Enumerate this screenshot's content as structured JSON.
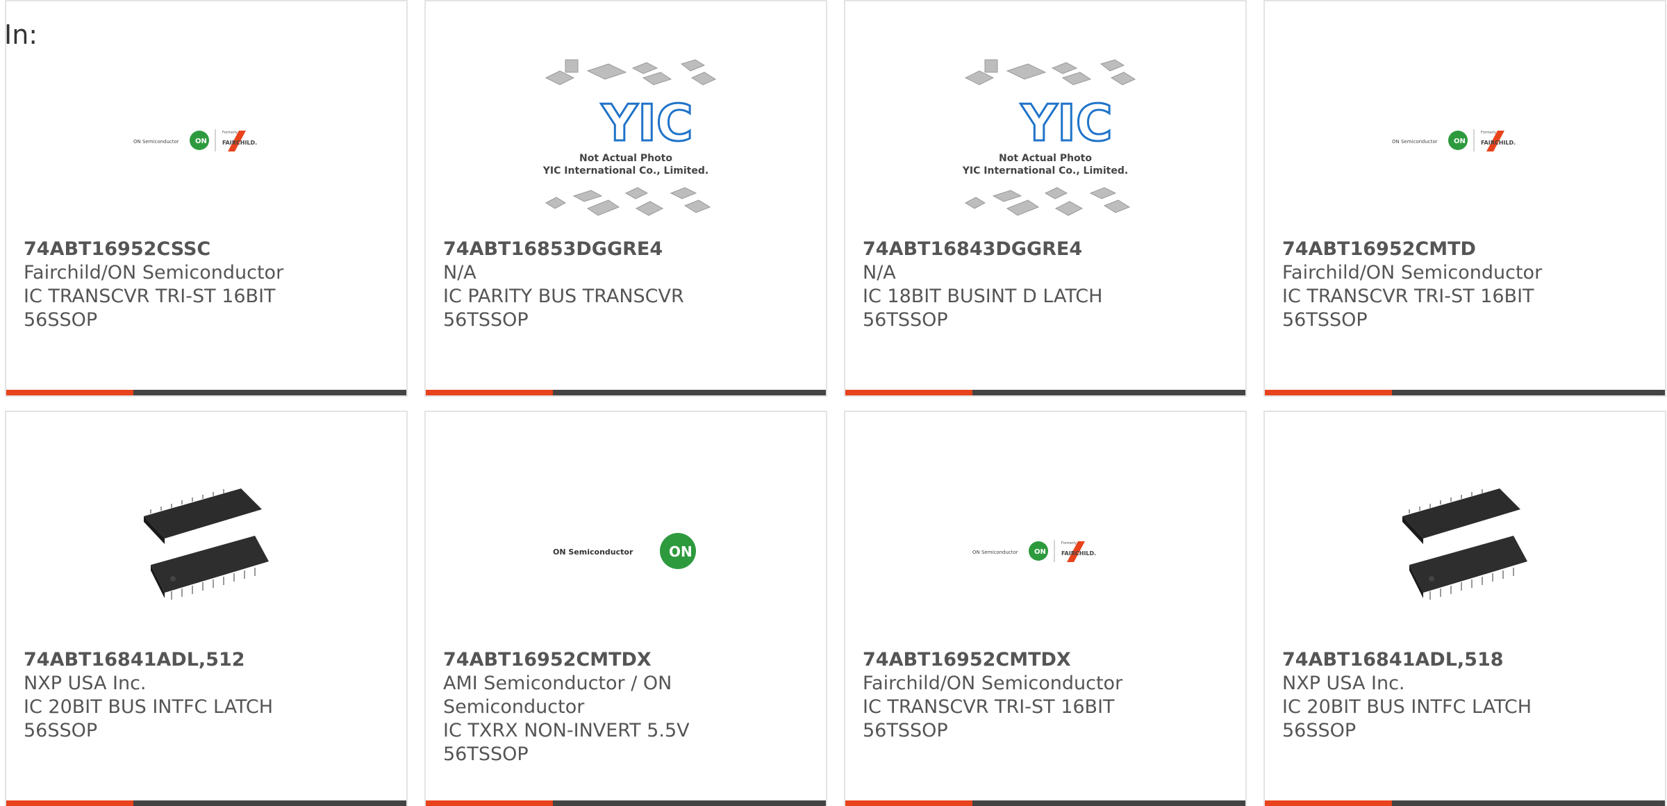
{
  "header": {
    "label": "In:"
  },
  "logos": {
    "on_semi_small": "ON Semiconductor",
    "formerly": "Formerly",
    "fairchild": "FAIRCHILD.",
    "on_badge": "ON",
    "on_semi_large": "ON Semiconductor"
  },
  "placeholder": {
    "brand": "YIC",
    "line1": "Not Actual Photo",
    "line2": "YIC International Co., Limited."
  },
  "colors": {
    "accent": "#e8431c",
    "bar": "#444444",
    "on_green": "#2e9a3e",
    "fairchild_red": "#e8431c",
    "yic_blue": "#1f73c9"
  },
  "products": [
    {
      "part": "74ABT16952CSSC",
      "maker": "Fairchild/ON Semiconductor",
      "desc1": "IC TRANSCVR TRI-ST 16BIT",
      "desc2": "56SSOP",
      "image": "on-fairchild-logo"
    },
    {
      "part": "74ABT16853DGGRE4",
      "maker": "N/A",
      "desc1": "IC PARITY BUS TRANSCVR",
      "desc2": "56TSSOP",
      "image": "yic-placeholder"
    },
    {
      "part": "74ABT16843DGGRE4",
      "maker": "N/A",
      "desc1": "IC 18BIT BUSINT D LATCH",
      "desc2": "56TSSOP",
      "image": "yic-placeholder"
    },
    {
      "part": "74ABT16952CMTD",
      "maker": "Fairchild/ON Semiconductor",
      "desc1": "IC TRANSCVR TRI-ST 16BIT",
      "desc2": "56TSSOP",
      "image": "on-fairchild-logo"
    },
    {
      "part": "74ABT16841ADL,512",
      "maker": "NXP USA Inc.",
      "desc1": "IC 20BIT BUS INTFC LATCH",
      "desc2": "56SSOP",
      "image": "chip-photo"
    },
    {
      "part": "74ABT16952CMTDX",
      "maker": "AMI Semiconductor / ON Semiconductor",
      "desc1": "IC TXRX NON-INVERT 5.5V",
      "desc2": "56TSSOP",
      "image": "on-semi-logo"
    },
    {
      "part": "74ABT16952CMTDX",
      "maker": "Fairchild/ON Semiconductor",
      "desc1": "IC TRANSCVR TRI-ST 16BIT",
      "desc2": "56TSSOP",
      "image": "on-fairchild-logo"
    },
    {
      "part": "74ABT16841ADL,518",
      "maker": "NXP USA Inc.",
      "desc1": "IC 20BIT BUS INTFC LATCH",
      "desc2": "56SSOP",
      "image": "chip-photo"
    }
  ]
}
